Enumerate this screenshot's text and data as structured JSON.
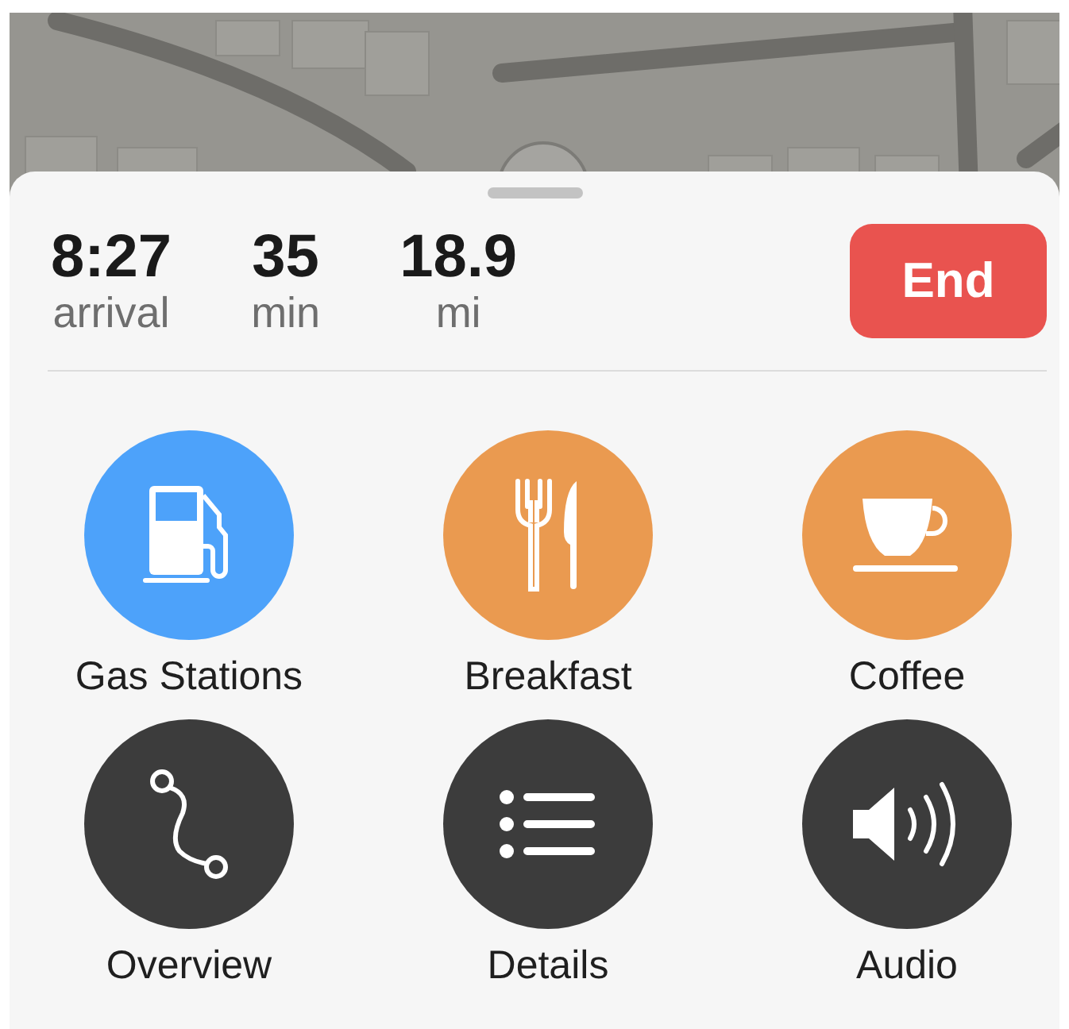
{
  "trip": {
    "stats": [
      {
        "value": "8:27",
        "unit": "arrival"
      },
      {
        "value": "35",
        "unit": "min"
      },
      {
        "value": "18.9",
        "unit": "mi"
      }
    ],
    "end_button": "End"
  },
  "actions": [
    {
      "label": "Gas Stations",
      "kind": "fuel",
      "color": "#4da2fa"
    },
    {
      "label": "Breakfast",
      "kind": "cutlery",
      "color": "#ea9a50"
    },
    {
      "label": "Coffee",
      "kind": "cup",
      "color": "#ea9a50"
    },
    {
      "label": "Overview",
      "kind": "route",
      "color": "#3c3c3c"
    },
    {
      "label": "Details",
      "kind": "list",
      "color": "#3c3c3c"
    },
    {
      "label": "Audio",
      "kind": "speaker",
      "color": "#3c3c3c"
    }
  ]
}
